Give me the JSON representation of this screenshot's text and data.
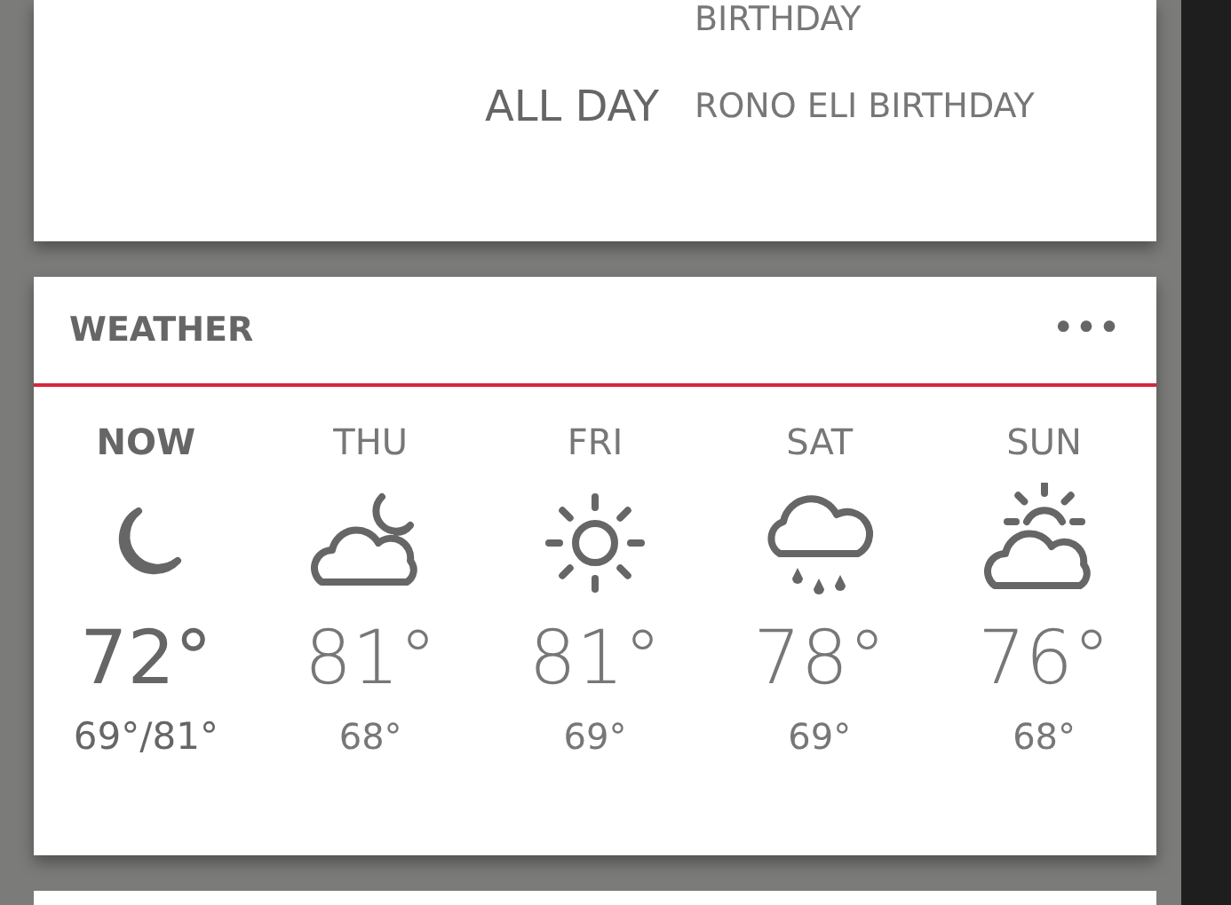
{
  "calendar": {
    "events": [
      {
        "title": "BIRTHDAY"
      },
      {
        "time": "ALL DAY",
        "title": "RONO ELI BIRTHDAY"
      }
    ]
  },
  "weather": {
    "title": "WEATHER",
    "menu": "•••",
    "days": [
      {
        "kind": "now",
        "label": "NOW",
        "temp": "72°",
        "low": "69°/81°"
      },
      {
        "kind": "forecast",
        "label": "THU",
        "temp": "81°",
        "low": "68°"
      },
      {
        "kind": "forecast",
        "label": "FRI",
        "temp": "81°",
        "low": "69°"
      },
      {
        "kind": "forecast",
        "label": "SAT",
        "temp": "78°",
        "low": "69°"
      },
      {
        "kind": "forecast",
        "label": "SUN",
        "temp": "76°",
        "low": "68°"
      }
    ]
  }
}
